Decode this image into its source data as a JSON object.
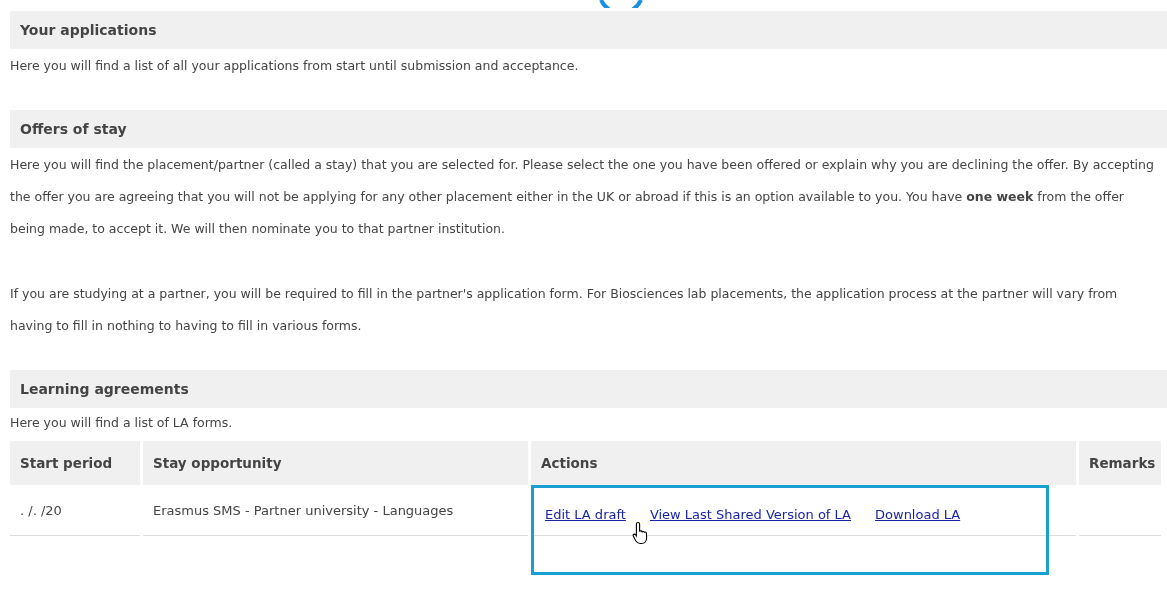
{
  "sections": [
    {
      "title": "Your applications",
      "paragraphs": [
        "Here you will find a list of all your applications from start until submission and acceptance."
      ]
    },
    {
      "title": "Offers of stay",
      "paragraphs": [
        "Here you will find the placement/partner (called a stay) that you are selected for. Please select the one you have been offered or explain why you are declining the offer. By accepting the offer you are agreeing that you will not be applying for any other placement either in the UK or abroad if this is an option available to you. You have **one week** from the offer being made, to accept it. We will then nominate you to that partner institution.",
        "If you are studying at a partner, you will be required to fill in the partner's application form. For Biosciences lab placements, the application process at the partner will vary from having to fill in nothing to having to fill in various forms."
      ]
    },
    {
      "title": "Learning agreements",
      "paragraphs": [
        "Here you will find a list of LA forms."
      ]
    }
  ],
  "table": {
    "columns": [
      "Start period",
      "Stay opportunity",
      "Actions",
      "Remarks"
    ],
    "rows": [
      {
        "start_period": ". /.  /20",
        "stay_opportunity": "Erasmus SMS - Partner university - Languages",
        "actions": [
          "Edit LA draft",
          "View Last Shared Version of LA",
          "Download LA"
        ],
        "highlighted": true
      }
    ]
  }
}
